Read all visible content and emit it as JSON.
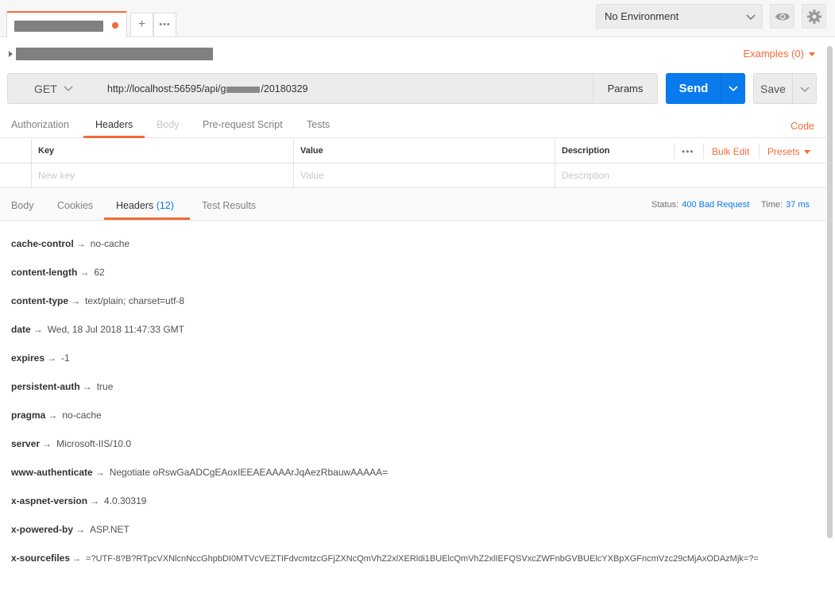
{
  "top_bar": {
    "new_tab_symbol": "+",
    "more_tabs_symbol": "•••",
    "environment": "No Environment"
  },
  "request_name_row": {
    "examples": "Examples (0)"
  },
  "url_bar": {
    "method": "GET",
    "url_prefix": "http://localhost:56595/api/",
    "url_middle_visible": "g",
    "url_suffix": "/20180329",
    "params": "Params",
    "send": "Send",
    "save": "Save"
  },
  "request_tabs": [
    "Authorization",
    "Headers",
    "Body",
    "Pre-request Script",
    "Tests"
  ],
  "request_tab_active": "Headers",
  "code_link": "Code",
  "headers_table": {
    "columns": [
      "Key",
      "Value",
      "Description"
    ],
    "more": "•••",
    "bulk_edit": "Bulk Edit",
    "presets": "Presets",
    "placeholder_key": "New key",
    "placeholder_value": "Value",
    "placeholder_description": "Description"
  },
  "response_tabs": {
    "body": "Body",
    "cookies": "Cookies",
    "headers": "Headers",
    "headers_count": "(12)",
    "test_results": "Test Results"
  },
  "response_meta": {
    "status_label": "Status:",
    "status_value": "400 Bad Request",
    "time_label": "Time:",
    "time_value": "37 ms"
  },
  "response_headers": [
    {
      "key": "cache-control",
      "value": "no-cache"
    },
    {
      "key": "content-length",
      "value": "62"
    },
    {
      "key": "content-type",
      "value": "text/plain; charset=utf-8"
    },
    {
      "key": "date",
      "value": "Wed, 18 Jul 2018 11:47:33 GMT"
    },
    {
      "key": "expires",
      "value": "-1"
    },
    {
      "key": "persistent-auth",
      "value": "true"
    },
    {
      "key": "pragma",
      "value": "no-cache"
    },
    {
      "key": "server",
      "value": "Microsoft-IIS/10.0"
    },
    {
      "key": "www-authenticate",
      "value": "Negotiate oRswGaADCgEAoxIEEAEAAAArJqAezRbauwAAAAA="
    },
    {
      "key": "x-aspnet-version",
      "value": "4.0.30319"
    },
    {
      "key": "x-powered-by",
      "value": "ASP.NET"
    },
    {
      "key": "x-sourcefiles",
      "value": "=?UTF-8?B?RTpcVXNlcnNccGhpbDI0MTVcVEZTIFdvcmtzcGFjZXNcQmVhZ2xlXERldi1BUElcQmVhZ2xlIEFQSVxcZWFnbGVBUElcYXBpXGFncmVzc29cMjAxODAzMjk=?="
    }
  ],
  "arrow_glyph": "→",
  "colors": {
    "accent_orange": "#f26b3a",
    "send_blue": "#097bed"
  }
}
